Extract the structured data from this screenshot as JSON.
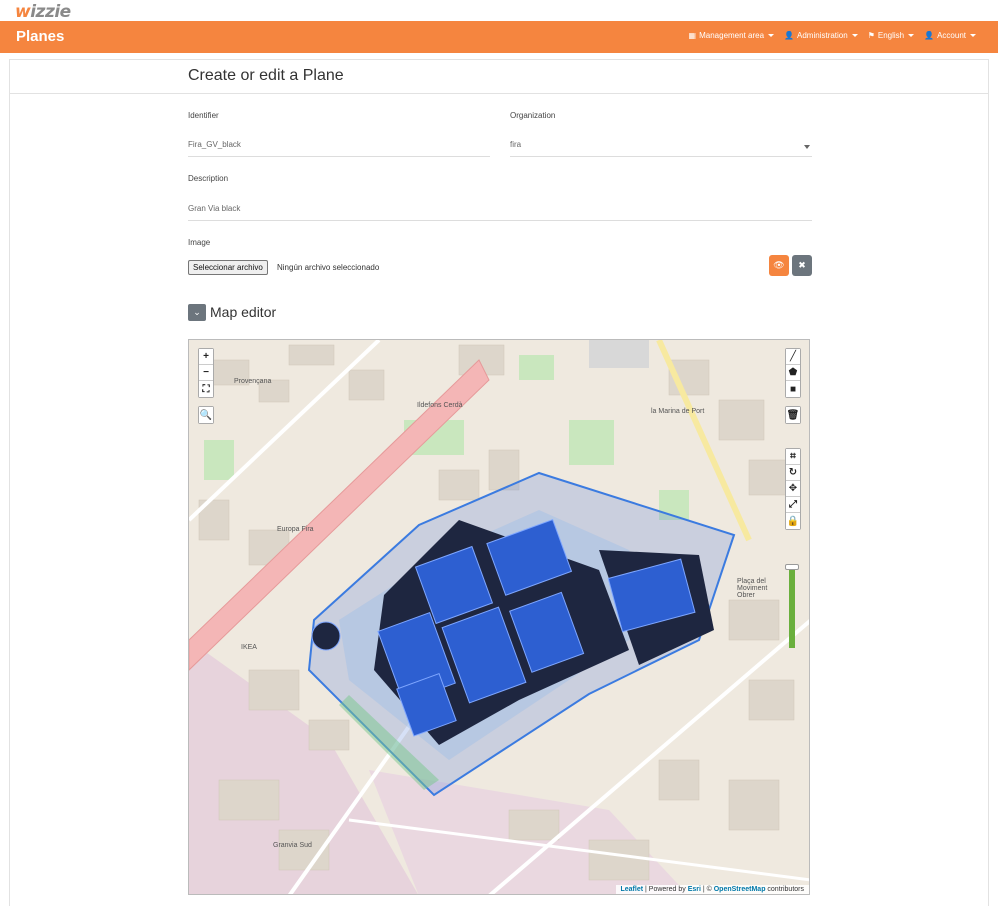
{
  "logo": {
    "first": "w",
    "rest": "izzie"
  },
  "navbar": {
    "brand": "Planes",
    "items": [
      {
        "icon": "table-icon",
        "glyph": "▦",
        "label": "Management area"
      },
      {
        "icon": "user-plus-icon",
        "glyph": "👤",
        "label": "Administration"
      },
      {
        "icon": "flag-icon",
        "glyph": "⚑",
        "label": "English"
      },
      {
        "icon": "user-icon",
        "glyph": "👤",
        "label": "Account"
      }
    ]
  },
  "page": {
    "title": "Create or edit a Plane"
  },
  "form": {
    "identifier": {
      "label": "Identifier",
      "value": "Fira_GV_black"
    },
    "organization": {
      "label": "Organization",
      "value": "fira"
    },
    "description": {
      "label": "Description",
      "value": "Gran Via black"
    },
    "image": {
      "label": "Image",
      "button": "Seleccionar archivo",
      "status": "Ningún archivo seleccionado"
    }
  },
  "map_editor": {
    "title": "Map editor",
    "zoom_in": "+",
    "zoom_out": "−",
    "attribution": {
      "leaflet": "Leaflet",
      "powered": " | Powered by ",
      "esri": "Esri",
      "sep": " | © ",
      "osm": "OpenStreetMap",
      "tail": " contributors"
    },
    "place_labels": [
      "Provençana",
      "Ildefons Cerdà",
      "Europa Fira",
      "IKEA",
      "Granvia Sud",
      "Plaça del Moviment Obrer",
      "la Marina de Port"
    ]
  },
  "colors": {
    "accent": "#f5853f",
    "secondary": "#6c757d",
    "link": "#0078a8"
  }
}
